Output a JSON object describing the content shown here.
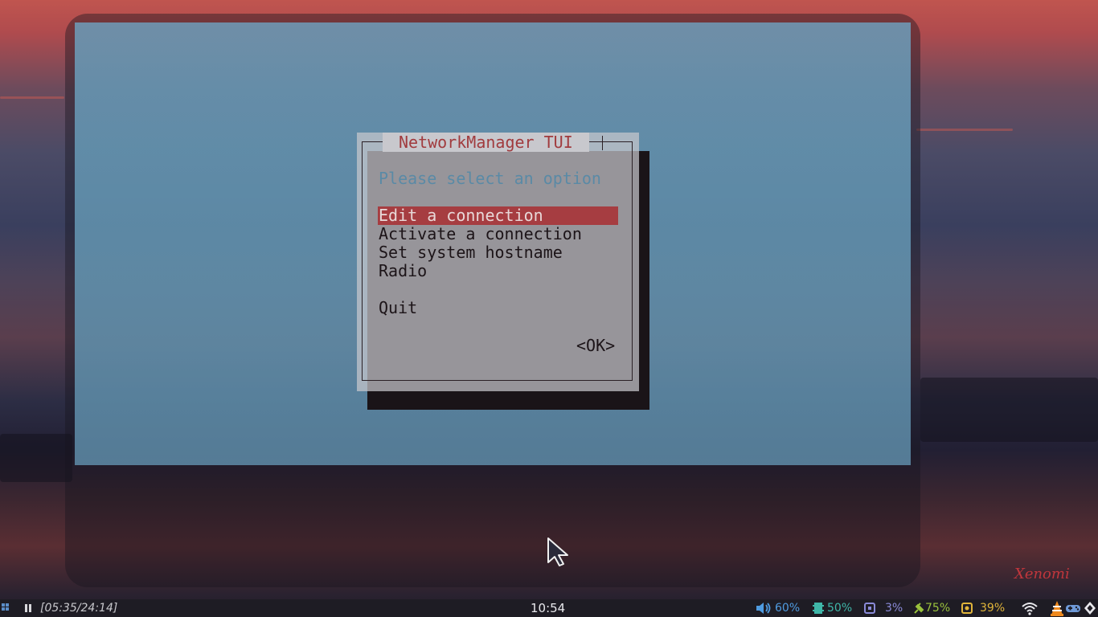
{
  "tui": {
    "title": "NetworkManager TUI",
    "prompt": "Please select an option",
    "menu_items": [
      {
        "label": "Edit a connection",
        "selected": true
      },
      {
        "label": "Activate a connection",
        "selected": false
      },
      {
        "label": "Set system hostname",
        "selected": false
      },
      {
        "label": "Radio",
        "selected": false
      }
    ],
    "quit_label": "Quit",
    "ok_label": "<OK>"
  },
  "taskbar": {
    "player_time": "[05:35/24:14]",
    "clock": "10:54",
    "volume": "60%",
    "memory": "50%",
    "cpu": "3%",
    "battery": "75%",
    "brightness": "39%"
  },
  "signature": "Xenomi",
  "colors": {
    "accent_red": "#a63d41",
    "prompt_blue": "#5a8aa6",
    "volume_color": "#4f9be0",
    "memory_color": "#3fb6a8",
    "cpu_color": "#8a8ad8",
    "battery_color": "#9ac23c",
    "brightness_color": "#e0b43a"
  }
}
